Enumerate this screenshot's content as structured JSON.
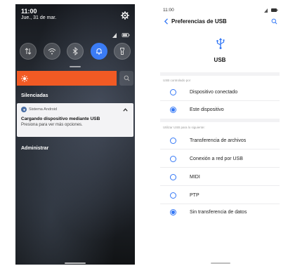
{
  "left": {
    "time": "11:00",
    "date": "Jue., 31 de mar.",
    "quick_settings": [
      {
        "icon": "data-transfer-icon",
        "active": false
      },
      {
        "icon": "wifi-icon",
        "active": false
      },
      {
        "icon": "bluetooth-icon",
        "active": false
      },
      {
        "icon": "bell-icon",
        "active": true
      },
      {
        "icon": "flashlight-icon",
        "active": false
      }
    ],
    "silenced_label": "Silenciadas",
    "notification": {
      "app_name": "Sistema Android",
      "title": "Cargando dispositivo mediante USB",
      "body": "Presiona para ver más opciones."
    },
    "manage_label": "Administrar",
    "colors": {
      "brightness": "#f15a24",
      "accent": "#3b7cf5"
    }
  },
  "right": {
    "time": "11:00",
    "title": "Preferencias de USB",
    "usb_label": "USB",
    "section1_label": "USB controlado por",
    "section1_options": [
      {
        "label": "Dispositivo conectado",
        "checked": false
      },
      {
        "label": "Este dispositivo",
        "checked": true
      }
    ],
    "section2_label": "Utilizar USB para lo siguiente:",
    "section2_options": [
      {
        "label": "Transferencia de archivos",
        "checked": false
      },
      {
        "label": "Conexión a red por USB",
        "checked": false
      },
      {
        "label": "MIDI",
        "checked": false
      },
      {
        "label": "PTP",
        "checked": false
      },
      {
        "label": "Sin transferencia de datos",
        "checked": true
      }
    ],
    "colors": {
      "accent": "#3478f6"
    }
  }
}
